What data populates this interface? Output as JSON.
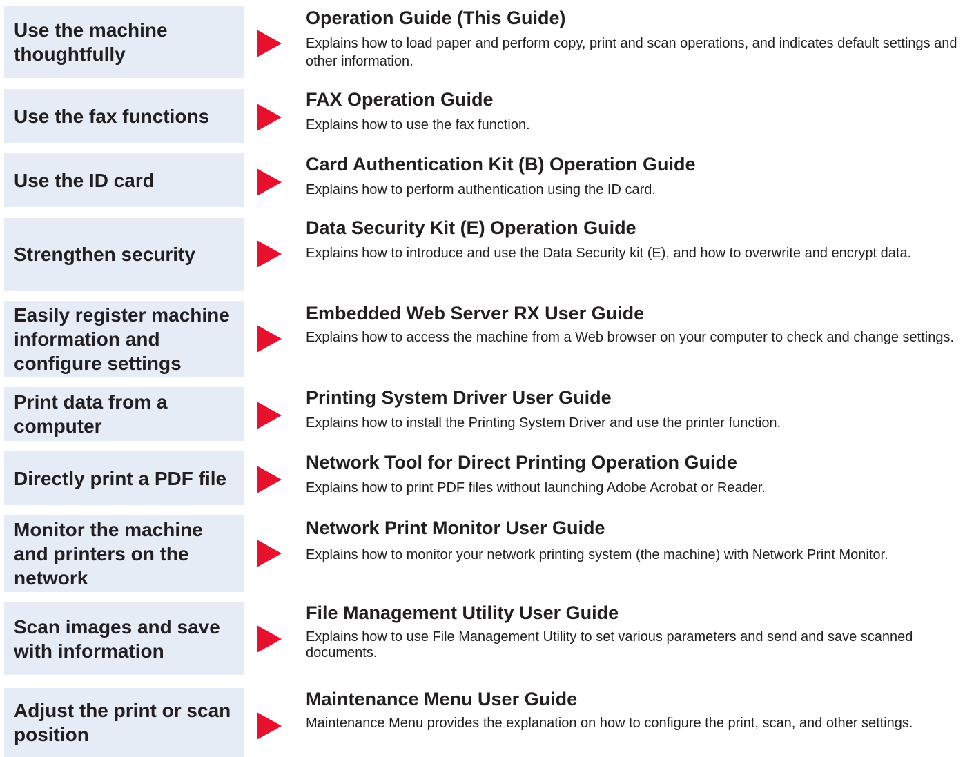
{
  "colors": {
    "box_background": "#e5ecf6",
    "arrow": "#e8112d",
    "text": "#231f20"
  },
  "rows": [
    {
      "purpose": "Use the machine thoughtfully",
      "title": "Operation Guide (This Guide)",
      "description": "Explains how to load paper and perform copy, print and scan operations, and indicates default settings and other information."
    },
    {
      "purpose": "Use the fax functions",
      "title": "FAX Operation Guide",
      "description": "Explains how to use the fax function."
    },
    {
      "purpose": "Use the ID card",
      "title": "Card Authentication Kit (B) Operation Guide",
      "description": "Explains how to perform authentication using the ID card."
    },
    {
      "purpose": "Strengthen security",
      "title": "Data Security Kit (E) Operation Guide",
      "description": "Explains how to introduce and use the Data Security kit (E), and how to overwrite and encrypt data."
    },
    {
      "purpose": "Easily register machine information and configure settings",
      "title": "Embedded Web Server RX User Guide",
      "description": "Explains how to access the machine from a Web browser on your computer to check and change settings."
    },
    {
      "purpose": "Print data from a computer",
      "title": "Printing System Driver User Guide",
      "description": "Explains how to install the Printing System Driver and use the printer function."
    },
    {
      "purpose": "Directly print a PDF file",
      "title": "Network Tool for Direct Printing Operation Guide",
      "description": "Explains how to print PDF files without launching Adobe Acrobat or Reader."
    },
    {
      "purpose": "Monitor the machine and printers on the network",
      "title": "Network Print Monitor User Guide",
      "description": "Explains how to monitor your network printing system (the machine) with Network Print Monitor."
    },
    {
      "purpose": "Scan images and save with information",
      "title": "File Management Utility User Guide",
      "description": "Explains how to use File Management Utility to set various parameters and send and save scanned documents."
    },
    {
      "purpose": "Adjust the print or scan position",
      "title": "Maintenance Menu User Guide",
      "description": "Maintenance Menu provides the explanation on how to configure the print, scan, and other settings."
    }
  ]
}
